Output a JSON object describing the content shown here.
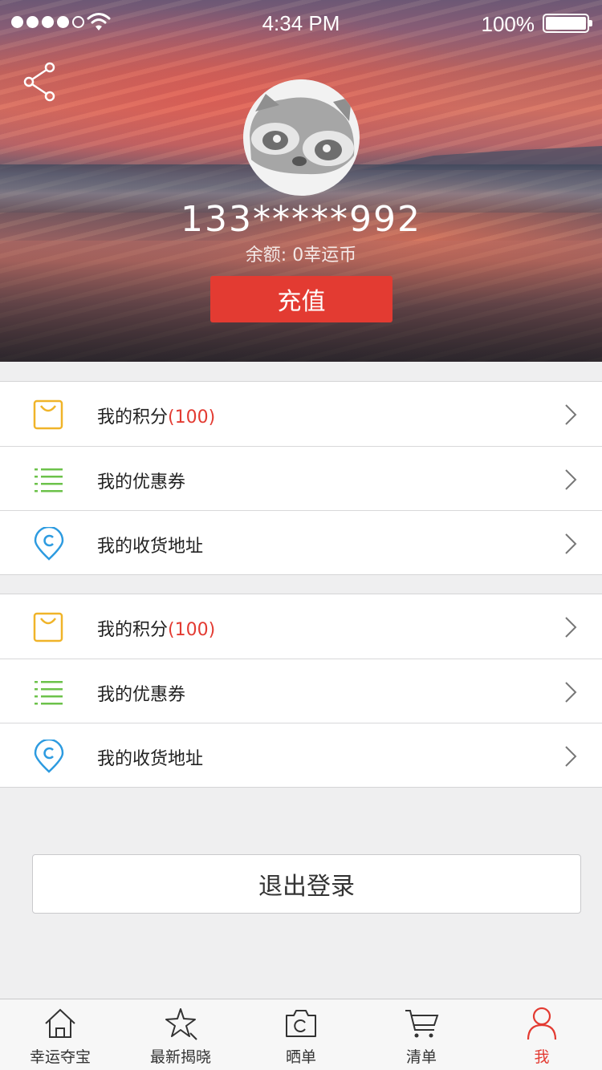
{
  "status_bar": {
    "time": "4:34 PM",
    "battery_text": "100%"
  },
  "profile": {
    "phone": "133*****992",
    "balance_label": "余额:",
    "balance_value": "0幸运币",
    "recharge_label": "充值"
  },
  "menu_groups": [
    [
      {
        "label": "我的积分",
        "count": "(100)",
        "icon": "shopping-bag-icon"
      },
      {
        "label": "我的优惠券",
        "count": "",
        "icon": "list-icon"
      },
      {
        "label": "我的收货地址",
        "count": "",
        "icon": "location-pin-icon"
      }
    ],
    [
      {
        "label": "我的积分",
        "count": "(100)",
        "icon": "shopping-bag-icon"
      },
      {
        "label": "我的优惠券",
        "count": "",
        "icon": "list-icon"
      },
      {
        "label": "我的收货地址",
        "count": "",
        "icon": "location-pin-icon"
      }
    ]
  ],
  "logout_label": "退出登录",
  "tabs": [
    {
      "label": "幸运夺宝",
      "icon": "home-icon"
    },
    {
      "label": "最新揭晓",
      "icon": "star-icon"
    },
    {
      "label": "晒单",
      "icon": "camera-icon"
    },
    {
      "label": "清单",
      "icon": "cart-icon"
    },
    {
      "label": "我",
      "icon": "user-icon",
      "active": true
    }
  ],
  "colors": {
    "accent": "#e33b32",
    "bag_icon": "#f0b429",
    "list_icon": "#6cc24a",
    "pin_icon": "#2d9be0"
  }
}
